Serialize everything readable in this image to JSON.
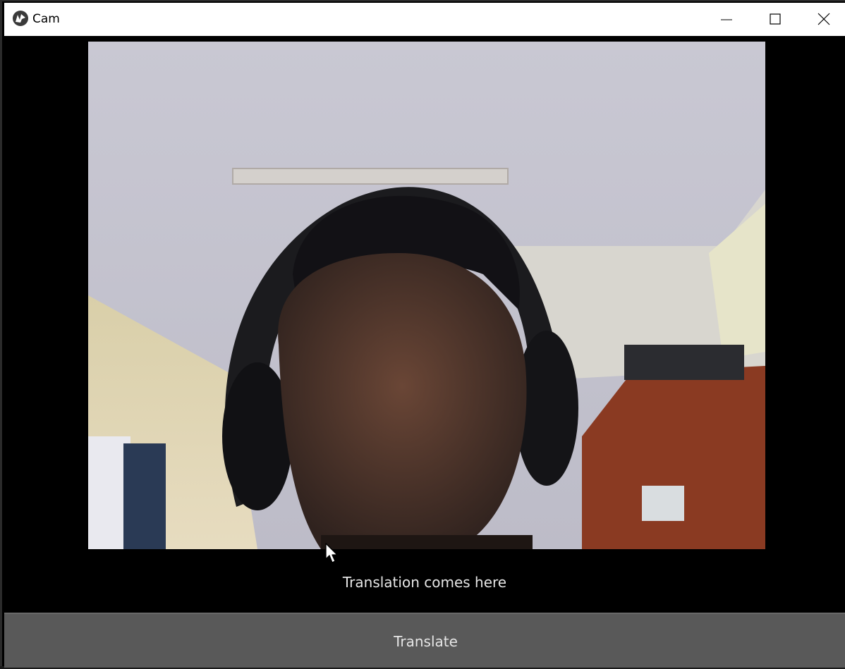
{
  "window": {
    "title": "Cam",
    "app_icon": "kivy-logo-icon",
    "controls": {
      "minimize": "minimize-icon",
      "maximize": "maximize-icon",
      "close": "close-icon"
    }
  },
  "camera": {
    "content": "live webcam feed"
  },
  "translation": {
    "text": "Translation comes here"
  },
  "actions": {
    "translate_label": "Translate"
  },
  "colors": {
    "background": "#000000",
    "button": "#595959",
    "text": "#e6e6e6"
  }
}
